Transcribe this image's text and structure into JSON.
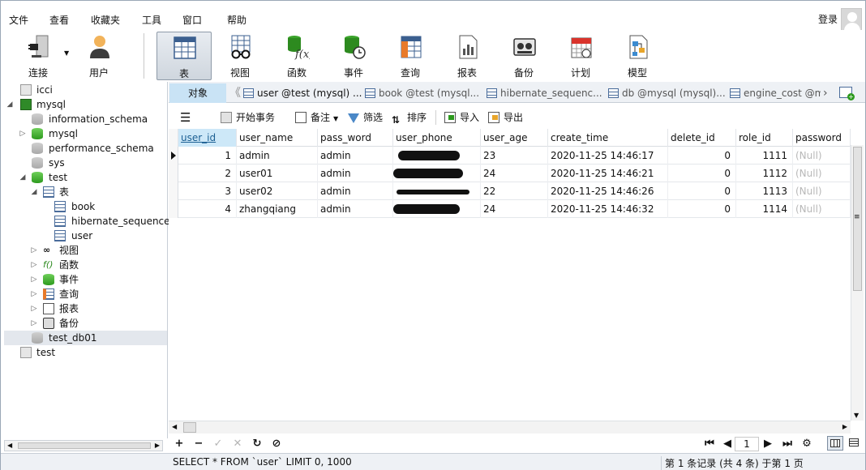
{
  "menu": [
    "文件",
    "查看",
    "收藏夹",
    "工具",
    "窗口",
    "帮助"
  ],
  "login_label": "登录",
  "toolbar": {
    "connect": "连接",
    "user": "用户",
    "table": "表",
    "view": "视图",
    "function": "函数",
    "event": "事件",
    "query": "查询",
    "report": "报表",
    "backup": "备份",
    "schedule": "计划",
    "model": "模型"
  },
  "sidebar": {
    "nodes": [
      "icci",
      "mysql",
      "information_schema",
      "mysql",
      "performance_schema",
      "sys",
      "test",
      "表",
      "book",
      "hibernate_sequence",
      "user",
      "视图",
      "函数",
      "事件",
      "查询",
      "报表",
      "备份",
      "test_db01",
      "test"
    ]
  },
  "tabs": {
    "objects": "对象",
    "items": [
      "user @test (mysql) ...",
      "book @test (mysql...",
      "hibernate_sequenc...",
      "db @mysql (mysql)...",
      "engine_cost @m"
    ]
  },
  "objbar": {
    "begin_tx": "开始事务",
    "memo": "备注",
    "filter": "筛选",
    "sort": "排序",
    "import": "导入",
    "export": "导出"
  },
  "grid": {
    "columns": [
      "user_id",
      "user_name",
      "pass_word",
      "user_phone",
      "user_age",
      "create_time",
      "delete_id",
      "role_id",
      "password"
    ],
    "rows": [
      {
        "user_id": "1",
        "user_name": "admin",
        "pass_word": "admin",
        "user_age": "23",
        "create_time": "2020-11-25 14:46:17",
        "delete_id": "0",
        "role_id": "1111",
        "password": "(Null)"
      },
      {
        "user_id": "2",
        "user_name": "user01",
        "pass_word": "admin",
        "user_age": "24",
        "create_time": "2020-11-25 14:46:21",
        "delete_id": "0",
        "role_id": "1112",
        "password": "(Null)"
      },
      {
        "user_id": "3",
        "user_name": "user02",
        "pass_word": "admin",
        "user_age": "22",
        "create_time": "2020-11-25 14:46:26",
        "delete_id": "0",
        "role_id": "1113",
        "password": "(Null)"
      },
      {
        "user_id": "4",
        "user_name": "zhangqiang",
        "pass_word": "admin",
        "user_age": "24",
        "create_time": "2020-11-25 14:46:32",
        "delete_id": "0",
        "role_id": "1114",
        "password": "(Null)"
      }
    ]
  },
  "page_number": "1",
  "status": {
    "sql": "SELECT * FROM `user` LIMIT 0, 1000",
    "records": "第 1 条记录 (共 4 条) 于第 1 页"
  }
}
